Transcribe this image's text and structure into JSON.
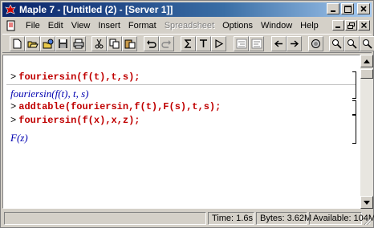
{
  "window": {
    "title": "Maple 7 - [Untitled (2) - [Server 1]]"
  },
  "menu": {
    "items": [
      {
        "label": "File",
        "disabled": false
      },
      {
        "label": "Edit",
        "disabled": false
      },
      {
        "label": "View",
        "disabled": false
      },
      {
        "label": "Insert",
        "disabled": false
      },
      {
        "label": "Format",
        "disabled": false
      },
      {
        "label": "Spreadsheet",
        "disabled": true
      },
      {
        "label": "Options",
        "disabled": false
      },
      {
        "label": "Window",
        "disabled": false
      },
      {
        "label": "Help",
        "disabled": false
      }
    ]
  },
  "toolbar": {
    "buttons": [
      "new-icon",
      "open-icon",
      "open-url-icon",
      "save-icon",
      "print-icon",
      "cut-icon",
      "copy-icon",
      "paste-icon",
      "undo-icon",
      "redo-icon",
      "sigma-icon",
      "text-mode-icon",
      "execute-group-icon",
      "indent-icon",
      "outdent-icon",
      "back-icon",
      "forward-icon",
      "stop-icon",
      "zoom-in-icon",
      "zoom-out-icon",
      "help-icon"
    ]
  },
  "worksheet": {
    "lines": [
      {
        "kind": "input",
        "prompt": ">",
        "text": "fouriersin(f(t),t,s);"
      },
      {
        "kind": "output",
        "text": "fouriersin(f(t), t, s)"
      },
      {
        "kind": "input",
        "prompt": ">",
        "text": "addtable(fouriersin,f(t),F(s),t,s);"
      },
      {
        "kind": "input",
        "prompt": ">",
        "text": "fouriersin(f(x),x,z);"
      },
      {
        "kind": "output",
        "text": "F(z)"
      }
    ]
  },
  "status": {
    "time": "Time: 1.6s",
    "bytes": "Bytes: 3.62M",
    "available": "Available: 104M"
  }
}
